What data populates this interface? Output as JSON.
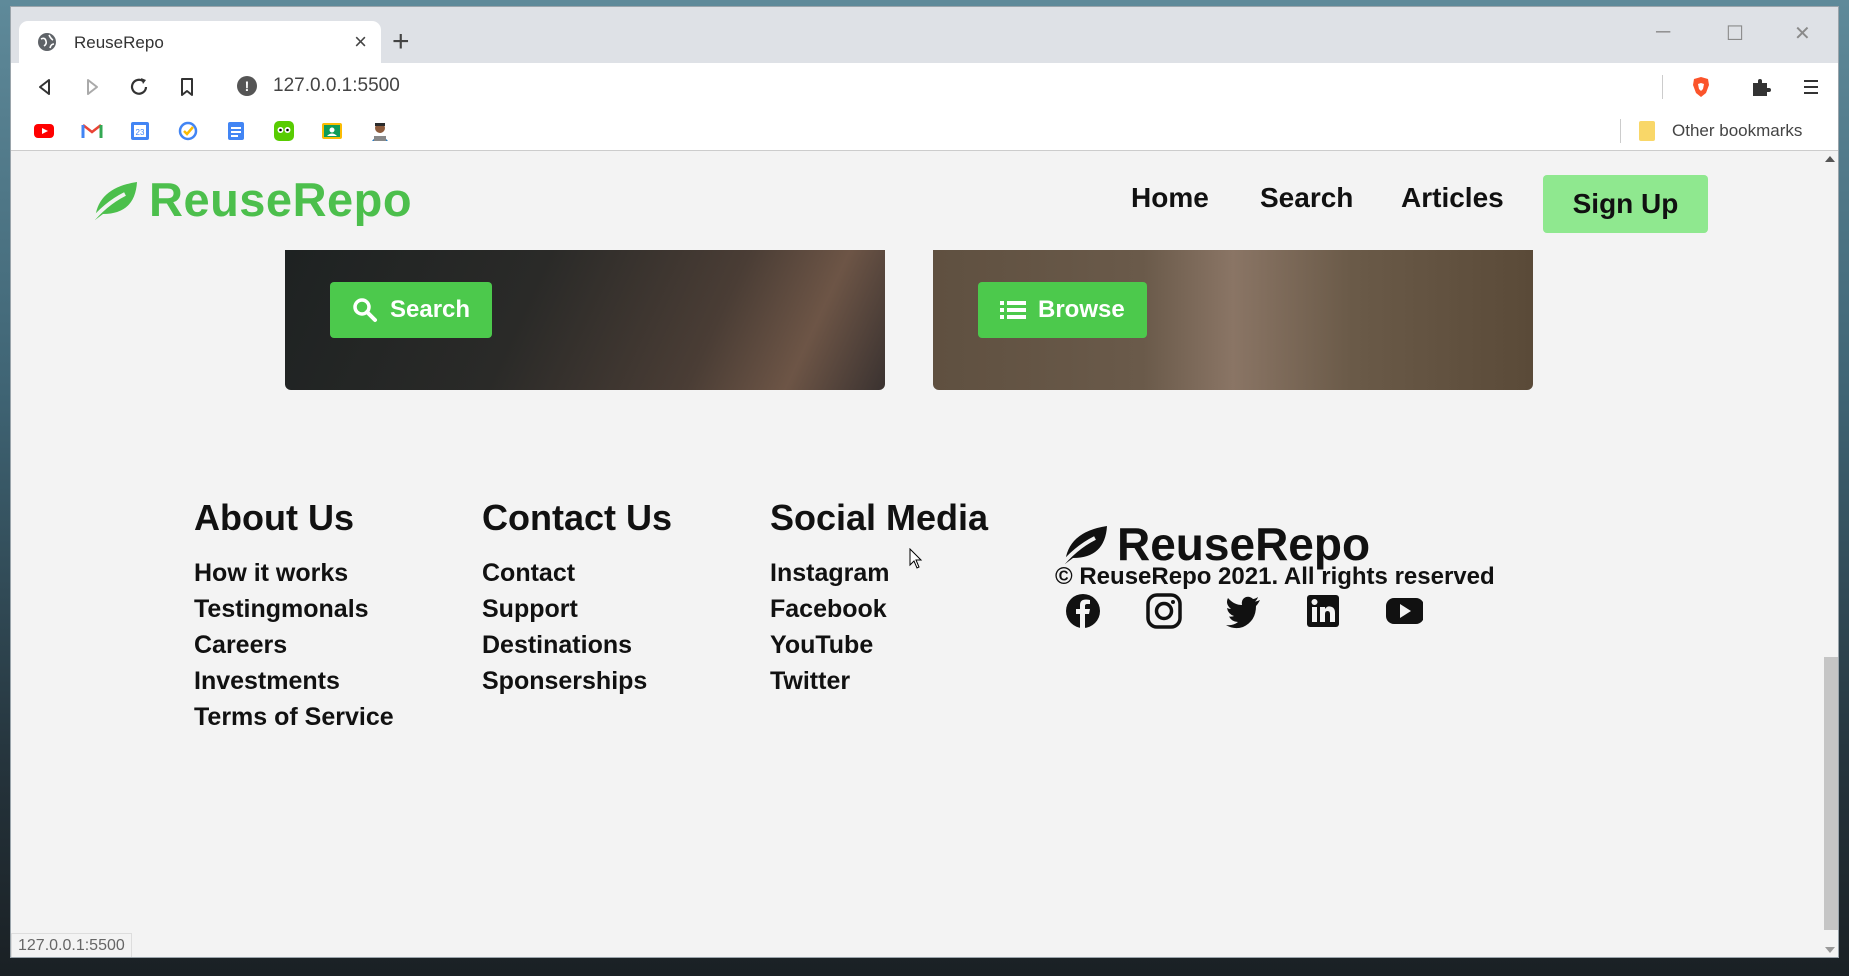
{
  "browser": {
    "tab_title": "ReuseRepo",
    "url": "127.0.0.1:5500",
    "other_bookmarks": "Other bookmarks",
    "status_url": "127.0.0.1:5500",
    "icons": [
      "back-icon",
      "forward-icon",
      "reload-icon",
      "bookmark-icon",
      "brave-icon",
      "extensions-icon",
      "menu-icon"
    ],
    "bookmark_icons": [
      "youtube-icon",
      "gmail-icon",
      "calendar-icon",
      "tasks-icon",
      "docs-icon",
      "duolingo-icon",
      "classroom-icon",
      "avatar-icon"
    ],
    "calendar_day": "23"
  },
  "site": {
    "logo": "ReuseRepo",
    "nav": {
      "home": "Home",
      "search": "Search",
      "articles": "Articles",
      "signup": "Sign Up"
    },
    "cards": {
      "search_button": "Search",
      "browse_button": "Browse"
    },
    "footer": {
      "about": {
        "title": "About Us",
        "links": [
          "How it works",
          "Testingmonals",
          "Careers",
          "Investments",
          "Terms of Service"
        ]
      },
      "contact": {
        "title": "Contact Us",
        "links": [
          "Contact",
          "Support",
          "Destinations",
          "Sponserships"
        ]
      },
      "social": {
        "title": "Social Media",
        "links": [
          "Instagram",
          "Facebook",
          "YouTube",
          "Twitter"
        ]
      },
      "brand": "ReuseRepo",
      "copyright": "© ReuseRepo 2021. All rights reserved",
      "social_icons": [
        "facebook-icon",
        "instagram-icon",
        "twitter-icon",
        "linkedin-icon",
        "youtube-icon"
      ]
    },
    "colors": {
      "brand_green": "#4cbf4c",
      "signup_bg": "#8fe88f",
      "button_green": "#4cc94c"
    }
  }
}
